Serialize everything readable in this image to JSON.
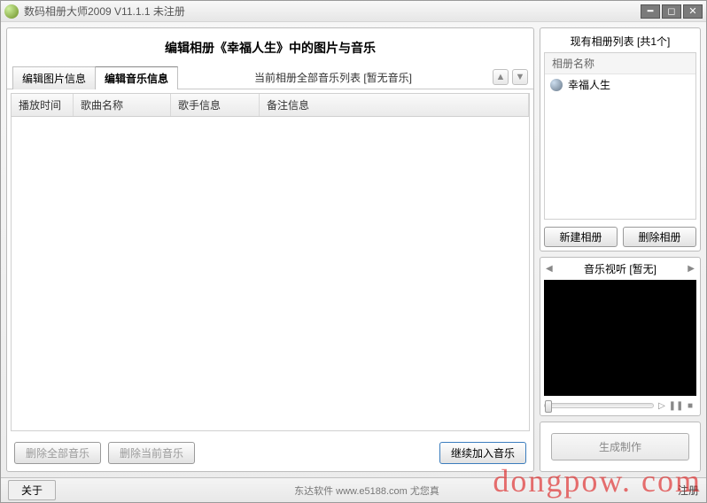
{
  "titlebar": {
    "title": "数码相册大师2009  V11.1.1  未注册"
  },
  "main": {
    "header": "编辑相册《幸福人生》中的图片与音乐",
    "tabs": {
      "pic": "编辑图片信息",
      "music": "编辑音乐信息"
    },
    "status": "当前相册全部音乐列表 [暂无音乐]",
    "columns": {
      "time": "播放时间",
      "title": "歌曲名称",
      "singer": "歌手信息",
      "memo": "备注信息"
    },
    "buttons": {
      "del_all": "删除全部音乐",
      "del_cur": "删除当前音乐",
      "add": "继续加入音乐"
    }
  },
  "side": {
    "albums_title": "现有相册列表 [共1个]",
    "albums_header": "相册名称",
    "album_items": [
      "幸福人生"
    ],
    "album_buttons": {
      "new": "新建相册",
      "del": "删除相册"
    },
    "preview_title": "音乐视听 [暂无]",
    "generate": "生成制作"
  },
  "footer": {
    "about": "关于",
    "mid": "东达软件 www.e5188.com 尤您真",
    "register": "注册"
  },
  "watermark": "dongpow. com"
}
